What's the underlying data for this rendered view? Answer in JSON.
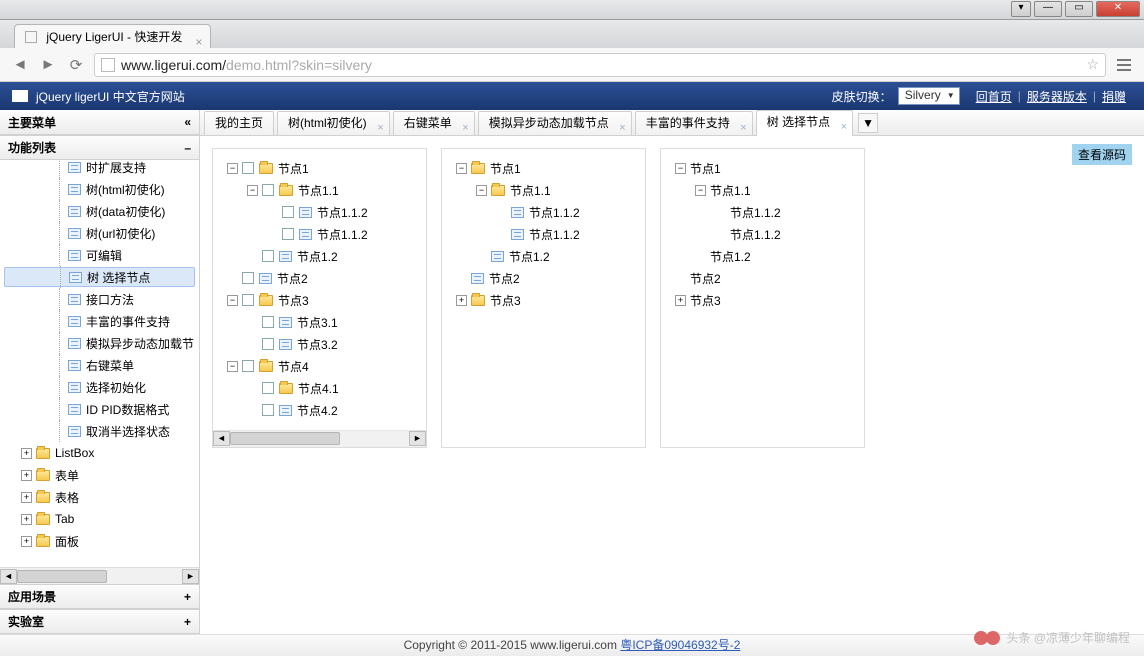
{
  "browser": {
    "tab_title": "jQuery LigerUI - 快速开发",
    "url_host": "www.ligerui.com/",
    "url_path": "demo.html?skin=silvery"
  },
  "appbar": {
    "title": "jQuery ligerUI 中文官方网站",
    "skin_label": "皮肤切换：",
    "skin_value": "Silvery",
    "links": {
      "home": "回首页",
      "server": "服务器版本",
      "donate": "捐赠"
    }
  },
  "sidebar": {
    "head": "主要菜单",
    "sections": {
      "list": "功能列表",
      "scene": "应用场景",
      "lab": "实验室"
    },
    "items": [
      {
        "label": "时扩展支持",
        "type": "grid",
        "indent": 48,
        "pm": "",
        "cut": true
      },
      {
        "label": "树(html初使化)",
        "type": "grid",
        "indent": 48,
        "pm": ""
      },
      {
        "label": "树(data初使化)",
        "type": "grid",
        "indent": 48,
        "pm": ""
      },
      {
        "label": "树(url初使化)",
        "type": "grid",
        "indent": 48,
        "pm": ""
      },
      {
        "label": "可编辑",
        "type": "grid",
        "indent": 48,
        "pm": ""
      },
      {
        "label": "树 选择节点",
        "type": "grid",
        "indent": 48,
        "pm": "",
        "sel": true
      },
      {
        "label": "接口方法",
        "type": "grid",
        "indent": 48,
        "pm": ""
      },
      {
        "label": "丰富的事件支持",
        "type": "grid",
        "indent": 48,
        "pm": ""
      },
      {
        "label": "模拟异步动态加载节",
        "type": "grid",
        "indent": 48,
        "pm": ""
      },
      {
        "label": "右键菜单",
        "type": "grid",
        "indent": 48,
        "pm": ""
      },
      {
        "label": "选择初始化",
        "type": "grid",
        "indent": 48,
        "pm": ""
      },
      {
        "label": "ID PID数据格式",
        "type": "grid",
        "indent": 48,
        "pm": ""
      },
      {
        "label": "取消半选择状态",
        "type": "grid",
        "indent": 48,
        "pm": ""
      },
      {
        "label": "ListBox",
        "type": "folder",
        "indent": 15,
        "pm": "+"
      },
      {
        "label": "表单",
        "type": "folder",
        "indent": 15,
        "pm": "+"
      },
      {
        "label": "表格",
        "type": "folder",
        "indent": 15,
        "pm": "+"
      },
      {
        "label": "Tab",
        "type": "folder",
        "indent": 15,
        "pm": "+"
      },
      {
        "label": "面板",
        "type": "folder",
        "indent": 15,
        "pm": "+",
        "cut": true
      }
    ]
  },
  "tabs": [
    {
      "label": "我的主页",
      "closable": false
    },
    {
      "label": "树(html初使化)",
      "closable": true
    },
    {
      "label": "右键菜单",
      "closable": true
    },
    {
      "label": "模拟异步动态加载节点",
      "closable": true
    },
    {
      "label": "丰富的事件支持",
      "closable": true
    },
    {
      "label": "树 选择节点",
      "closable": true,
      "active": true
    }
  ],
  "view_source": "查看源码",
  "trees": {
    "a": [
      {
        "label": "节点1",
        "indent": 0,
        "pm": "−",
        "cb": true,
        "folder": true
      },
      {
        "label": "节点1.1",
        "indent": 1,
        "pm": "−",
        "cb": true,
        "folder": true
      },
      {
        "label": "节点1.1.2",
        "indent": 2,
        "pm": "",
        "cb": true,
        "grid": true
      },
      {
        "label": "节点1.1.2",
        "indent": 2,
        "pm": "",
        "cb": true,
        "grid": true
      },
      {
        "label": "节点1.2",
        "indent": 1,
        "pm": "",
        "cb": true,
        "grid": true
      },
      {
        "label": "节点2",
        "indent": 0,
        "pm": "",
        "cb": true,
        "grid": true
      },
      {
        "label": "节点3",
        "indent": 0,
        "pm": "−",
        "cb": true,
        "folder": true
      },
      {
        "label": "节点3.1",
        "indent": 1,
        "pm": "",
        "cb": true,
        "grid": true
      },
      {
        "label": "节点3.2",
        "indent": 1,
        "pm": "",
        "cb": true,
        "grid": true
      },
      {
        "label": "节点4",
        "indent": 0,
        "pm": "−",
        "cb": true,
        "folder": true
      },
      {
        "label": "节点4.1",
        "indent": 1,
        "pm": "",
        "cb": true,
        "folder": true
      },
      {
        "label": "节点4.2",
        "indent": 1,
        "pm": "",
        "cb": true,
        "grid": true
      }
    ],
    "b": [
      {
        "label": "节点1",
        "indent": 0,
        "pm": "−",
        "folder": true
      },
      {
        "label": "节点1.1",
        "indent": 1,
        "pm": "−",
        "folder": true
      },
      {
        "label": "节点1.1.2",
        "indent": 2,
        "pm": "",
        "grid": true
      },
      {
        "label": "节点1.1.2",
        "indent": 2,
        "pm": "",
        "grid": true
      },
      {
        "label": "节点1.2",
        "indent": 1,
        "pm": "",
        "grid": true
      },
      {
        "label": "节点2",
        "indent": 0,
        "pm": "",
        "grid": true
      },
      {
        "label": "节点3",
        "indent": 0,
        "pm": "+",
        "folder": true
      }
    ],
    "c": [
      {
        "label": "节点1",
        "indent": 0,
        "pm": "−"
      },
      {
        "label": "节点1.1",
        "indent": 1,
        "pm": "−"
      },
      {
        "label": "节点1.1.2",
        "indent": 2,
        "pm": ""
      },
      {
        "label": "节点1.1.2",
        "indent": 2,
        "pm": ""
      },
      {
        "label": "节点1.2",
        "indent": 1,
        "pm": ""
      },
      {
        "label": "节点2",
        "indent": 0,
        "pm": ""
      },
      {
        "label": "节点3",
        "indent": 0,
        "pm": "+"
      }
    ]
  },
  "footer": {
    "copy": "Copyright © 2011-2015 www.ligerui.com ",
    "icp": "粤ICP备09046932号-2"
  },
  "watermark": "头条 @凉薄少年聊编程"
}
